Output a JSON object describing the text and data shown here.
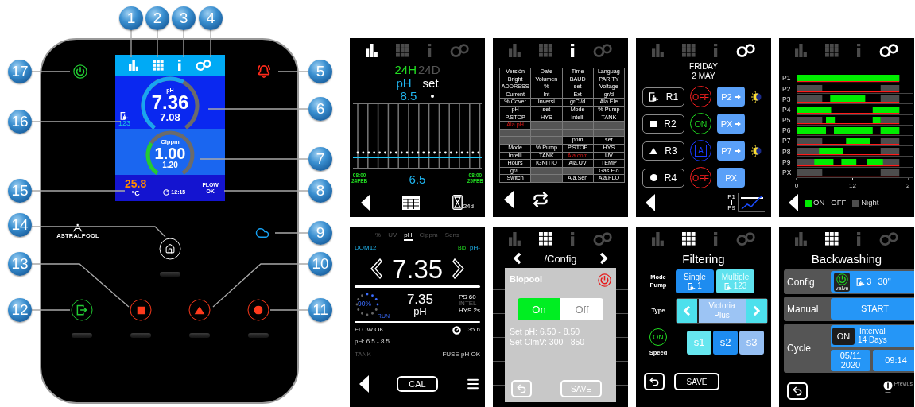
{
  "device": {
    "callouts": [
      "1",
      "2",
      "3",
      "4",
      "17",
      "5",
      "6",
      "16",
      "7",
      "15",
      "8",
      "14",
      "9",
      "13",
      "10",
      "12",
      "11"
    ],
    "logo": "ASTRALPOOL",
    "display": {
      "gauges": [
        {
          "label": "pH",
          "value": "7.36",
          "setpoint": "7.08"
        },
        {
          "label": "Clppm",
          "value": "1.00",
          "setpoint": "1.20"
        }
      ],
      "pump_count": "123",
      "temperature": "25.8",
      "temperature_unit": "°C",
      "time": "12:15",
      "flow": "FLOW\nOK"
    }
  },
  "history_screen": {
    "tabs": [
      {
        "selected": true
      },
      {
        "selected": false
      },
      {
        "selected": false
      },
      {
        "selected": false
      }
    ],
    "ranges": [
      {
        "label": "24H",
        "selected": true
      },
      {
        "label": "24D",
        "selected": false
      }
    ],
    "parameter": "pH",
    "set_label": "set",
    "max": "8.5",
    "min": "6.5",
    "start": "08:00\n24FEB",
    "end": "08:00\n25FEB",
    "period": "24d"
  },
  "info_screen": {
    "tabs": [
      {
        "selected": false
      },
      {
        "selected": false
      },
      {
        "selected": true
      },
      {
        "selected": false
      }
    ],
    "table": [
      [
        {
          "kind": "label",
          "text": "Versión"
        },
        {
          "kind": "label",
          "text": "Date"
        },
        {
          "kind": "label",
          "text": "Time"
        },
        {
          "kind": "label",
          "text": "Languag"
        }
      ],
      [
        {
          "kind": "label",
          "text": "Bright"
        },
        {
          "kind": "label",
          "text": "Volumen"
        },
        {
          "kind": "label",
          "text": "BAUD"
        },
        {
          "kind": "label",
          "text": "PARITY"
        }
      ],
      [
        {
          "kind": "label",
          "text": "ADDRESS"
        },
        {
          "kind": "label",
          "text": "%"
        },
        {
          "kind": "label",
          "text": "set"
        },
        {
          "kind": "label",
          "text": "Voltage"
        }
      ],
      [
        {
          "kind": "label",
          "text": "Current"
        },
        {
          "kind": "label",
          "text": "Int"
        },
        {
          "kind": "label",
          "text": "Ext"
        },
        {
          "kind": "label",
          "text": "gr/d"
        }
      ],
      [
        {
          "kind": "label",
          "text": "% Cover"
        },
        {
          "kind": "label",
          "text": "Inversi"
        },
        {
          "kind": "label",
          "text": "grCl/d"
        },
        {
          "kind": "label",
          "text": "Ala.Ele"
        }
      ],
      [
        {
          "kind": "label",
          "text": "pH"
        },
        {
          "kind": "label",
          "text": "set"
        },
        {
          "kind": "label",
          "text": "Mode"
        },
        {
          "kind": "label",
          "text": "% Pump"
        }
      ],
      [
        {
          "kind": "label",
          "text": "P.STOP"
        },
        {
          "kind": "label",
          "text": "HYS"
        },
        {
          "kind": "label",
          "text": "Intelli"
        },
        {
          "kind": "label",
          "text": "TANK"
        }
      ],
      [
        {
          "kind": "alarm",
          "text": "Ala.pH"
        },
        {
          "kind": "empty"
        },
        {
          "kind": "empty"
        },
        {
          "kind": "empty"
        }
      ],
      [
        {
          "kind": "empty"
        },
        {
          "kind": "empty"
        },
        {
          "kind": "empty"
        },
        {
          "kind": "empty"
        }
      ],
      [
        {
          "kind": "empty"
        },
        {
          "kind": "empty"
        },
        {
          "kind": "label",
          "text": "ppm"
        },
        {
          "kind": "label",
          "text": "set"
        }
      ],
      [
        {
          "kind": "label",
          "text": "Mode"
        },
        {
          "kind": "label",
          "text": "% Pump"
        },
        {
          "kind": "label",
          "text": "P.STOP"
        },
        {
          "kind": "label",
          "text": "HYS"
        }
      ],
      [
        {
          "kind": "label",
          "text": "Intelli"
        },
        {
          "kind": "label",
          "text": "TANK"
        },
        {
          "kind": "alarm",
          "text": "Ala.com"
        },
        {
          "kind": "label",
          "text": "UV"
        }
      ],
      [
        {
          "kind": "label",
          "text": "Hours"
        },
        {
          "kind": "label",
          "text": "IGNITIO"
        },
        {
          "kind": "label",
          "text": "Ala.UV"
        },
        {
          "kind": "label",
          "text": "TEMP"
        }
      ],
      [
        {
          "kind": "label",
          "text": "gr/L"
        },
        {
          "kind": "empty"
        },
        {
          "kind": "empty"
        },
        {
          "kind": "label",
          "text": "Gas.Flo"
        }
      ],
      [
        {
          "kind": "label",
          "text": "Switch"
        },
        {
          "kind": "empty"
        },
        {
          "kind": "label",
          "text": "Ala.Sen"
        },
        {
          "kind": "label",
          "text": "Ala.FLO"
        }
      ]
    ]
  },
  "relays_screen": {
    "tabs": [
      {
        "selected": false
      },
      {
        "selected": false
      },
      {
        "selected": false
      },
      {
        "selected": true
      }
    ],
    "day": "FRIDAY",
    "date": "2 MAY",
    "relays": [
      {
        "label": "R1",
        "mode": {
          "kind": "off",
          "text": "OFF"
        },
        "program": {
          "label": "P2",
          "arrow": true,
          "night": true
        }
      },
      {
        "label": "R2",
        "mode": {
          "kind": "on",
          "text": "ON"
        },
        "program": {
          "label": "PX",
          "arrow": true,
          "night": false
        }
      },
      {
        "label": "R3",
        "mode": {
          "kind": "auto",
          "text": "A"
        },
        "program": {
          "label": "P7",
          "arrow": true,
          "night": true
        }
      },
      {
        "label": "R4",
        "mode": {
          "kind": "off",
          "text": "OFF"
        },
        "program": {
          "label": "PX",
          "arrow": false,
          "night": false
        }
      }
    ],
    "range_first": "P1",
    "range_last": "P9"
  },
  "programs_screen": {
    "tabs": [
      {
        "selected": false
      },
      {
        "selected": false
      },
      {
        "selected": false
      },
      {
        "selected": true
      }
    ],
    "rows": [
      "P1",
      "P2",
      "P3",
      "P4",
      "P5",
      "P6",
      "P7",
      "P8",
      "P9",
      "PX"
    ],
    "axis_labels": [
      "0",
      "12",
      "2"
    ],
    "legend": [
      "ON",
      "OFF",
      "Night"
    ]
  },
  "ph_screen": {
    "tabs": [
      {
        "label": "%",
        "selected": false
      },
      {
        "label": "UV",
        "selected": false
      },
      {
        "label": "pH",
        "selected": true
      },
      {
        "label": "Clppm",
        "selected": false
      },
      {
        "label": "Sens",
        "selected": false
      }
    ],
    "model": "DOM12",
    "mode": "Bio",
    "dosing": "pH-",
    "reading": "7.35",
    "percent": "90%",
    "status": "RUN",
    "value": "7.35",
    "unit": "pH",
    "indicators": [
      {
        "text": "PS 60",
        "active": true
      },
      {
        "text": "INTEL",
        "active": false
      },
      {
        "text": "HYS 2s",
        "active": true
      }
    ],
    "flow": "FLOW OK",
    "hours": "35 h",
    "range": "pH: 6.5 - 8.5",
    "tank": {
      "text": "TANK",
      "active": false
    },
    "fuse": {
      "text": "FUSE pH OK",
      "active": true
    },
    "cal": "CAL"
  },
  "config_screen": {
    "tabs": [
      {
        "selected": false
      },
      {
        "selected": true
      },
      {
        "selected": false
      },
      {
        "selected": false
      }
    ],
    "title": "/Config",
    "dialog": {
      "title": "Biopool",
      "toggle": [
        {
          "label": "On",
          "selected": true
        },
        {
          "label": "Off",
          "selected": false
        }
      ],
      "lines": [
        "Set pH: 6.50 - 8.50",
        "Set ClmV: 300 - 850"
      ],
      "save": "SAVE"
    }
  },
  "filtering_screen": {
    "tabs": [
      {
        "selected": false
      },
      {
        "selected": true
      },
      {
        "selected": false
      },
      {
        "selected": false
      }
    ],
    "title": "Filtering",
    "mode_label": "Mode\nPump",
    "modes": [
      {
        "label": "Single",
        "count": "1",
        "selected": true
      },
      {
        "label": "Multiple",
        "count": "123",
        "selected": false
      }
    ],
    "type_label": "Type",
    "type_value": "Victoria\nPlus",
    "speed_state": "ON",
    "speed_label": "Speed",
    "speeds": [
      {
        "label": "s1",
        "selected": false,
        "disabled": false
      },
      {
        "label": "s2",
        "selected": true,
        "disabled": false
      },
      {
        "label": "s3",
        "selected": false,
        "disabled": true
      }
    ],
    "save": "SAVE"
  },
  "backwashing_screen": {
    "tabs": [
      {
        "selected": false
      },
      {
        "selected": true
      },
      {
        "selected": false
      },
      {
        "selected": false
      }
    ],
    "title": "Backwashing",
    "config_label": "Config",
    "valve_label": "valve",
    "pump_count": "3",
    "duration": "30\"",
    "manual_label": "Manual",
    "start": "START",
    "cycle_label": "Cycle",
    "cycle_state": "ON",
    "interval": "Interval\n14 Days",
    "date": "05/11\n2020",
    "time": "09:14",
    "previous": "Previus"
  }
}
